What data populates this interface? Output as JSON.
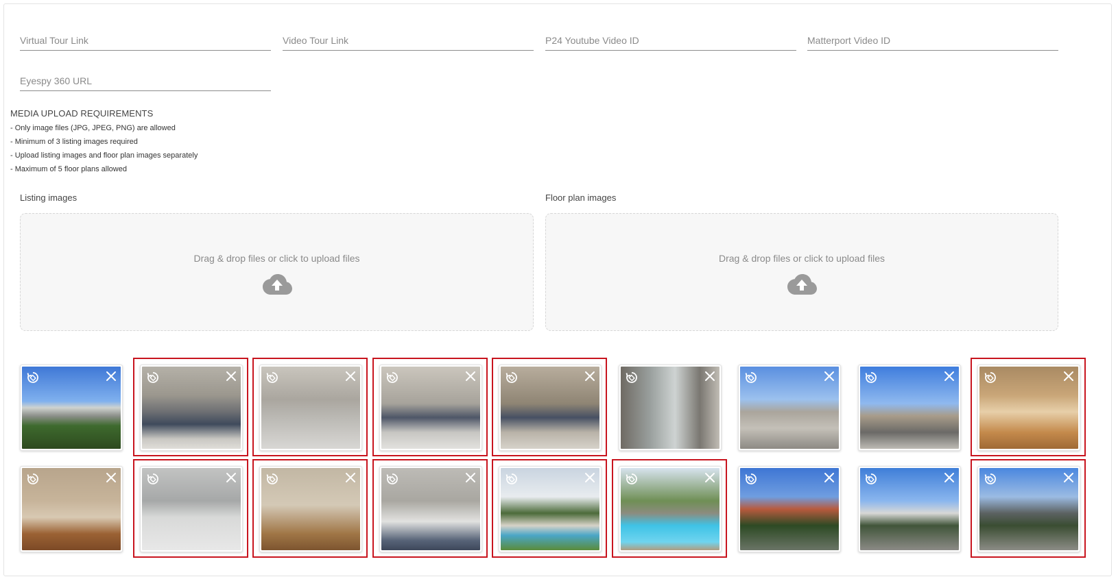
{
  "fields": {
    "virtual_tour": {
      "placeholder": "Virtual Tour Link",
      "value": ""
    },
    "video_tour": {
      "placeholder": "Video Tour Link",
      "value": ""
    },
    "p24_youtube": {
      "placeholder": "P24 Youtube Video ID",
      "value": ""
    },
    "matterport": {
      "placeholder": "Matterport Video ID",
      "value": ""
    },
    "eyespy": {
      "placeholder": "Eyespy 360 URL",
      "value": ""
    }
  },
  "requirements": {
    "title": "MEDIA UPLOAD REQUIREMENTS",
    "items": [
      "- Only image files (JPG, JPEG, PNG) are allowed",
      "- Minimum of 3 listing images required",
      "- Upload listing images and floor plan images separately",
      "- Maximum of 5 floor plans allowed"
    ]
  },
  "uploads": {
    "listing_label": "Listing images",
    "floorplan_label": "Floor plan images",
    "dropzone_text": "Drag & drop files or click to upload files"
  },
  "icons": {
    "upload": "cloud-upload-icon",
    "rotate": "rotate-icon",
    "remove": "close-icon"
  },
  "colors": {
    "selection_border": "#c8141e",
    "dropzone_bg": "#f7f7f7",
    "icon_gray": "#9a9a9a"
  },
  "thumbnails": [
    {
      "photo": "street",
      "selected": false
    },
    {
      "photo": "kitchen",
      "selected": true
    },
    {
      "photo": "room",
      "selected": true
    },
    {
      "photo": "room2",
      "selected": true
    },
    {
      "photo": "room3",
      "selected": true
    },
    {
      "photo": "slider",
      "selected": false
    },
    {
      "photo": "balcony",
      "selected": false
    },
    {
      "photo": "balcony2",
      "selected": false
    },
    {
      "photo": "sunroom",
      "selected": true
    },
    {
      "photo": "bedroom",
      "selected": false
    },
    {
      "photo": "bath",
      "selected": true
    },
    {
      "photo": "bedroom2",
      "selected": true
    },
    {
      "photo": "bath2",
      "selected": true
    },
    {
      "photo": "house",
      "selected": true
    },
    {
      "photo": "pool",
      "selected": true
    },
    {
      "photo": "palm",
      "selected": false
    },
    {
      "photo": "parking",
      "selected": false
    },
    {
      "photo": "garden",
      "selected": true
    }
  ]
}
